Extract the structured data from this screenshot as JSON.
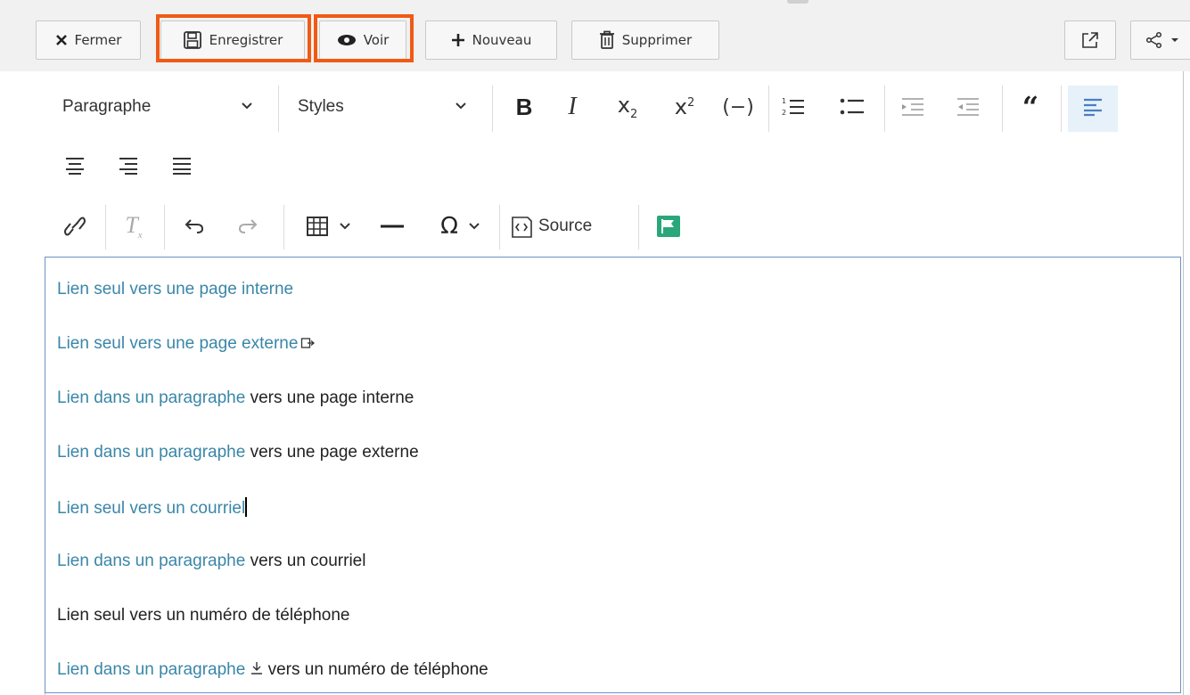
{
  "actions": {
    "close": "Fermer",
    "save": "Enregistrer",
    "view": "Voir",
    "new": "Nouveau",
    "delete": "Supprimer"
  },
  "toolbar": {
    "paragraph_format": "Paragraphe",
    "styles": "Styles",
    "source": "Source",
    "icons": [
      "bold-icon",
      "italic-icon",
      "subscript-icon",
      "superscript-icon",
      "code-icon",
      "numbered-list-icon",
      "bulleted-list-icon",
      "outdent-icon",
      "indent-icon",
      "blockquote-icon",
      "align-left-icon",
      "align-center-icon",
      "align-right-icon",
      "justify-icon",
      "link-icon",
      "remove-format-icon",
      "undo-icon",
      "redo-icon",
      "table-icon",
      "horizontal-line-icon",
      "special-char-icon",
      "source-icon",
      "flag-icon"
    ]
  },
  "content": {
    "p1": {
      "link": "Lien seul vers une page interne"
    },
    "p2": {
      "link": "Lien seul vers une page externe"
    },
    "p3": {
      "link": "Lien dans un paragraphe",
      "text": " vers une page interne"
    },
    "p4": {
      "link": "Lien dans un paragraphe",
      "text": " vers une page externe"
    },
    "p5": {
      "link": "Lien seul vers un courriel"
    },
    "p6": {
      "link": "Lien dans un paragraphe",
      "text": " vers un courriel"
    },
    "p7": {
      "text": "Lien seul vers un numéro de téléphone"
    },
    "p8": {
      "link": "Lien dans un paragraphe",
      "text": " vers un numéro de téléphone"
    }
  },
  "colors": {
    "link": "#3a86a8",
    "highlight": "#f05a14",
    "flag": "#2aa77a",
    "active": "#4a7fc1"
  }
}
